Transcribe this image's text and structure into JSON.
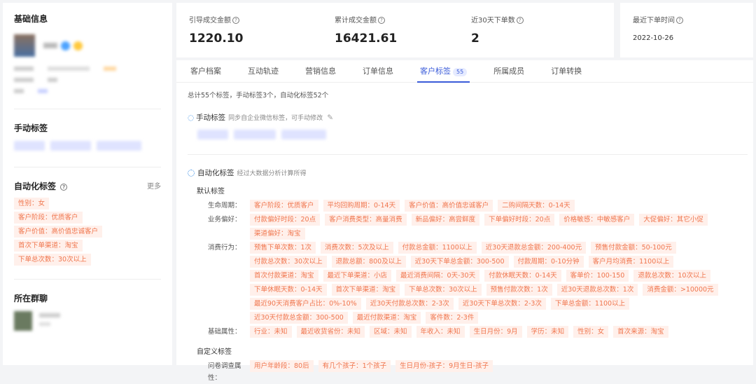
{
  "left": {
    "basic_title": "基础信息",
    "manual_title": "手动标签",
    "auto_title": "自动化标签",
    "more": "更多",
    "auto_tags": [
      "性别：女",
      "客户阶段：优质客户",
      "客户价值：高价值忠诚客户",
      "首次下单渠道：淘宝",
      "下单总次数：30次以上"
    ],
    "group_title": "所在群聊"
  },
  "stats": [
    {
      "label": "引导成交金额",
      "value": "1220.10"
    },
    {
      "label": "累计成交金额",
      "value": "16421.61"
    },
    {
      "label": "近30天下单数",
      "value": "2"
    },
    {
      "label": "最近下单时间",
      "value": "2022-10-26"
    }
  ],
  "tabs": [
    {
      "label": "客户档案"
    },
    {
      "label": "互动轨迹"
    },
    {
      "label": "营销信息"
    },
    {
      "label": "订单信息"
    },
    {
      "label": "客户标签",
      "badge": "55"
    },
    {
      "label": "所属成员"
    },
    {
      "label": "订单转换"
    }
  ],
  "summary": "总计55个标签，手动标签3个，自动化标签52个",
  "manual": {
    "title": "手动标签",
    "desc": "同步自企业微信标签，可手动修改"
  },
  "auto": {
    "title": "自动化标签",
    "desc": "经过大数据分析计算所得",
    "default_title": "默认标签",
    "custom_title": "自定义标签"
  },
  "rows": [
    {
      "label": "生命周期：",
      "tags": [
        "客户阶段：优质客户",
        "平均回购周期：0-14天",
        "客户价值：高价值忠诚客户",
        "二购间隔天数：0-14天"
      ]
    },
    {
      "label": "业务偏好：",
      "tags": [
        "付款偏好时段：20点",
        "客户消费类型：高量消费",
        "新品偏好：高尝鲜度",
        "下单偏好时段：20点",
        "价格敏感：中敏感客户",
        "大促偏好：其它小促",
        "渠道偏好：淘宝"
      ]
    },
    {
      "label": "消费行为：",
      "tags": [
        "预售下单次数：1次",
        "消费次数：5次及以上",
        "付款总金额：1100以上",
        "近30天退款总金额：200-400元",
        "预售付款金额：50-100元",
        "付款总次数：30次以上",
        "退款总额：800及以上",
        "近30天下单总金额：300-500",
        "付款周期：0-10分钟",
        "客户月均消费：1100以上",
        "首次付款渠道：淘宝",
        "最近下单渠道：小店",
        "最近消费间隔：0天-30天",
        "付款休眠天数：0-14天",
        "客单价：100-150",
        "退款总次数：10次以上",
        "下单休眠天数：0-14天",
        "首次下单渠道：淘宝",
        "下单总次数：30次以上",
        "预售付款次数：1次",
        "近30天退款总次数：1次",
        "消费金额：>10000元",
        "最近90天消费客户占比：0%-10%",
        "近30天付款总次数：2-3次",
        "近30天下单总次数：2-3次",
        "下单总金额：1100以上",
        "近30天付款总金额：300-500",
        "最近付款渠道：淘宝",
        "客件数：2-3件"
      ]
    },
    {
      "label": "基础属性：",
      "tags": [
        "行业：未知",
        "最近收货省份：未知",
        "区域：未知",
        "年收入：未知",
        "生日月份：9月",
        "学历：未知",
        "性别：女",
        "首次来源：淘宝"
      ]
    }
  ],
  "custom_rows": [
    {
      "label": "问卷调查属性：",
      "tags": [
        "用户年龄段：80后",
        "有几个孩子：1个孩子",
        "生日月份-孩子：9月生日-孩子"
      ]
    }
  ]
}
